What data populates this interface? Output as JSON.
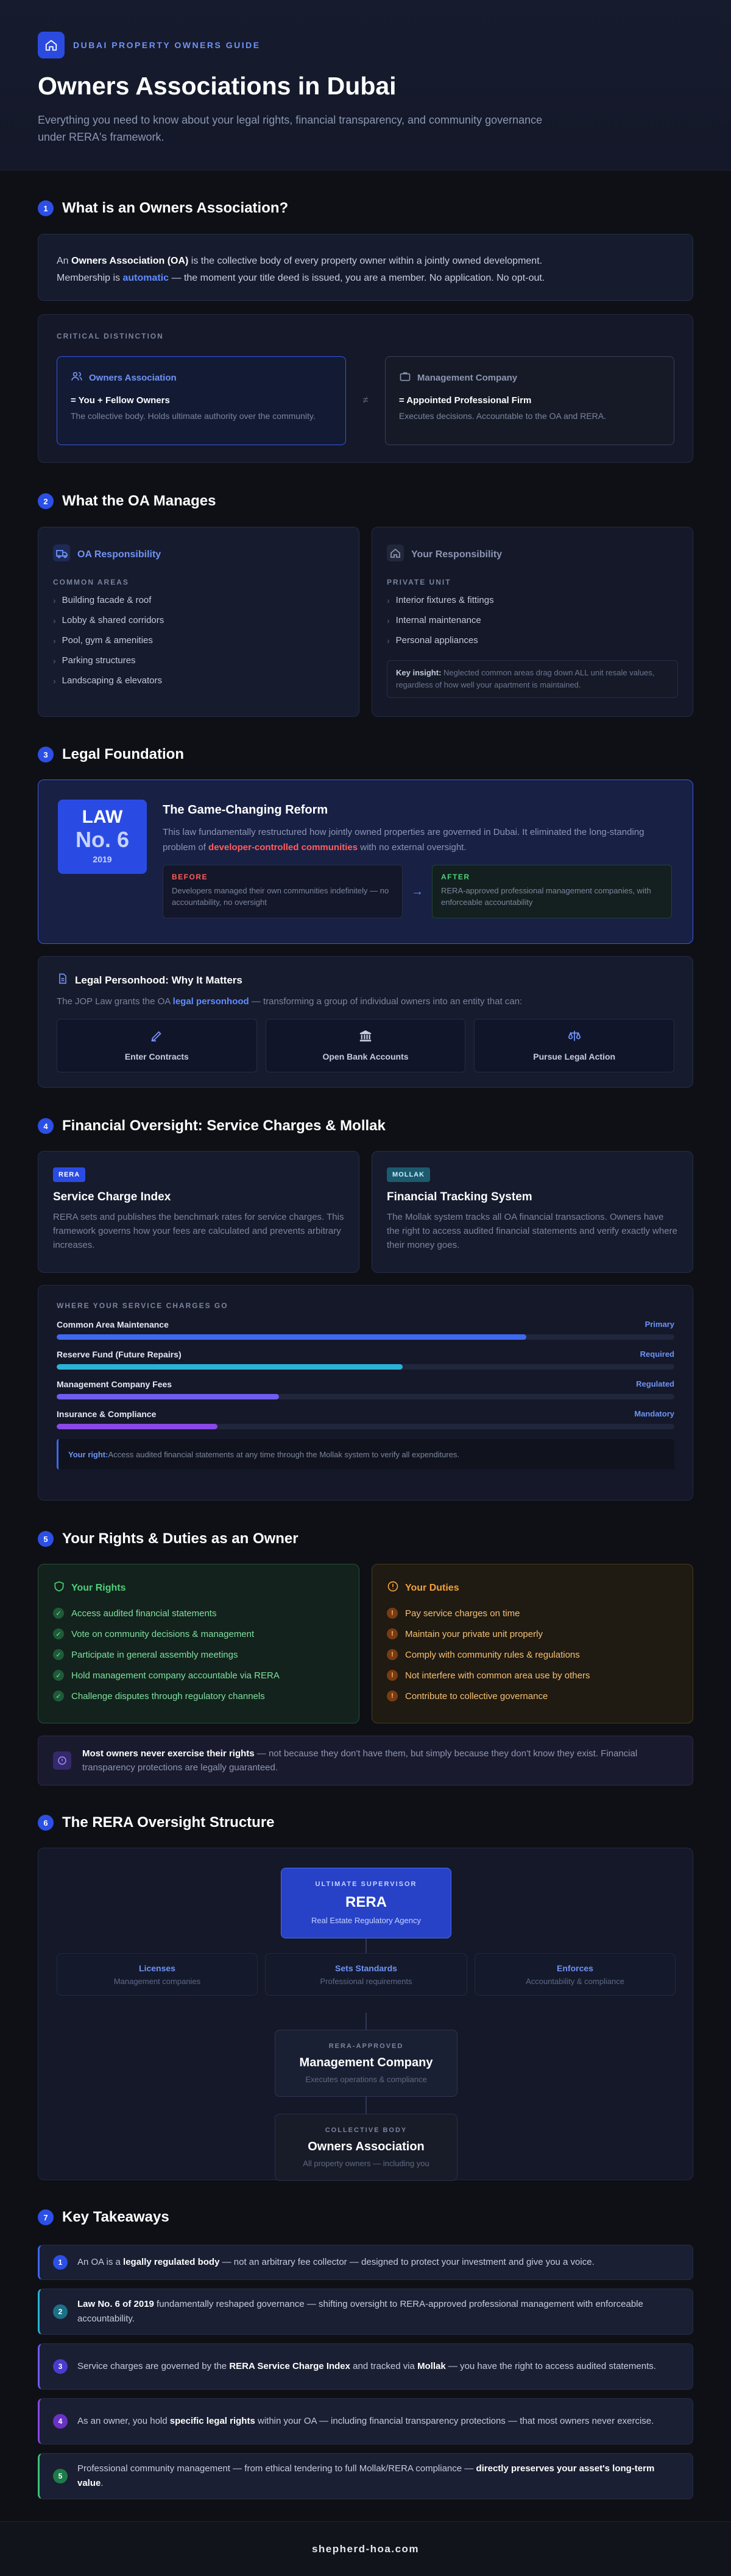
{
  "header": {
    "brand": "DUBAI PROPERTY OWNERS GUIDE",
    "title": "Owners Associations in Dubai",
    "subtitle": "Everything you need to know about your legal rights, financial transparency, and community governance under RERA's framework."
  },
  "s1": {
    "num": "1",
    "title": "What is an Owners Association?",
    "intro_a": "An ",
    "intro_b": "Owners Association (OA)",
    "intro_c": " is the collective body of every property owner within a jointly owned development.",
    "intro_d": "Membership is ",
    "intro_e": "automatic",
    "intro_f": " — the moment your title deed is issued, you are a member. No application. No opt-out.",
    "distinction_label": "CRITICAL DISTINCTION",
    "oa": {
      "title": "Owners Association",
      "eq": "= You + Fellow Owners",
      "desc": "The collective body. Holds ultimate authority over the community."
    },
    "vs": "≠",
    "mc": {
      "title": "Management Company",
      "eq": "= Appointed Professional Firm",
      "desc": "Executes decisions. Accountable to the OA and RERA."
    }
  },
  "s2": {
    "num": "2",
    "title": "What the OA Manages",
    "oa_card": {
      "title": "OA Responsibility",
      "label": "COMMON AREAS",
      "items": [
        "Building facade & roof",
        "Lobby & shared corridors",
        "Pool, gym & amenities",
        "Parking structures",
        "Landscaping & elevators"
      ]
    },
    "you_card": {
      "title": "Your Responsibility",
      "label": "PRIVATE UNIT",
      "items": [
        "Interior fixtures & fittings",
        "Internal maintenance",
        "Personal appliances"
      ]
    },
    "insight_label": "Key insight:",
    "insight_text": " Neglected common areas drag down ALL unit resale values, regardless of how well your apartment is maintained."
  },
  "s3": {
    "num": "3",
    "title": "Legal Foundation",
    "badge_top": "LAW",
    "badge_mid": "No. 6",
    "badge_year": "2019",
    "reform_title": "The Game-Changing Reform",
    "reform_a": "This law fundamentally restructured how jointly owned properties are governed in Dubai. It eliminated the long-standing problem of ",
    "reform_b": "developer-controlled communities",
    "reform_c": " with no external oversight.",
    "before_label": "BEFORE",
    "before_text": "Developers managed their own communities indefinitely — no accountability, no oversight",
    "arrow": "→",
    "after_label": "AFTER",
    "after_text": "RERA-approved professional management companies, with enforceable accountability",
    "lp_title": "Legal Personhood: Why It Matters",
    "lp_a": "The JOP Law grants the OA ",
    "lp_b": "legal personhood",
    "lp_c": " — transforming a group of individual owners into an entity that can:",
    "powers": [
      "Enter Contracts",
      "Open Bank Accounts",
      "Pursue Legal Action"
    ]
  },
  "s4": {
    "num": "4",
    "title": "Financial Oversight: Service Charges & Mollak",
    "rera_tag": "RERA",
    "rera_title": "Service Charge Index",
    "rera_desc": "RERA sets and publishes the benchmark rates for service charges. This framework governs how your fees are calculated and prevents arbitrary increases.",
    "mollak_tag": "MOLLAK",
    "mollak_title": "Financial Tracking System",
    "mollak_desc": "The Mollak system tracks all OA financial transactions. Owners have the right to access audited financial statements and verify exactly where their money goes.",
    "charges_label": "WHERE YOUR SERVICE CHARGES GO",
    "charges": [
      {
        "name": "Common Area Maintenance",
        "tag": "Primary",
        "fill": 0.76,
        "color": "#3f68f0"
      },
      {
        "name": "Reserve Fund (Future Repairs)",
        "tag": "Required",
        "fill": 0.56,
        "color": "#2ab3d6"
      },
      {
        "name": "Management Company Fees",
        "tag": "Regulated",
        "fill": 0.36,
        "color": "#6f5cf0"
      },
      {
        "name": "Insurance & Compliance",
        "tag": "Mandatory",
        "fill": 0.26,
        "color": "#8a48e6"
      }
    ],
    "right_label": "Your right:",
    "right_text": " Access audited financial statements at any time through the Mollak system to verify all expenditures."
  },
  "s5": {
    "num": "5",
    "title": "Your Rights & Duties as an Owner",
    "rights_title": "Your Rights",
    "rights": [
      "Access audited financial statements",
      "Vote on community decisions & management",
      "Participate in general assembly meetings",
      "Hold management company accountable via RERA",
      "Challenge disputes through regulatory channels"
    ],
    "duties_title": "Your Duties",
    "duties": [
      "Pay service charges on time",
      "Maintain your private unit properly",
      "Comply with community rules & regulations",
      "Not interfere with common area use by others",
      "Contribute to collective governance"
    ],
    "note_a": "Most owners never exercise their rights",
    "note_b": " — not because they don't have them, but simply because they don't know they exist. Financial transparency protections are legally guaranteed."
  },
  "s6": {
    "num": "6",
    "title": "The RERA Oversight Structure",
    "top_label": "ULTIMATE SUPERVISOR",
    "top_title": "RERA",
    "top_desc": "Real Estate Regulatory Agency",
    "pillars": [
      {
        "title": "Licenses",
        "desc": "Management companies"
      },
      {
        "title": "Sets Standards",
        "desc": "Professional requirements"
      },
      {
        "title": "Enforces",
        "desc": "Accountability & compliance"
      }
    ],
    "mid_label": "RERA-APPROVED",
    "mid_title": "Management Company",
    "mid_desc": "Executes operations & compliance",
    "bot_label": "COLLECTIVE BODY",
    "bot_title": "Owners Association",
    "bot_desc": "All property owners — including you"
  },
  "s7": {
    "num": "7",
    "title": "Key Takeaways",
    "t1_a": "An OA is a ",
    "t1_b": "legally regulated body",
    "t1_c": " — not an arbitrary fee collector — designed to protect your investment and give you a voice.",
    "t2_a": "",
    "t2_b": "Law No. 6 of 2019",
    "t2_c": " fundamentally reshaped governance — shifting oversight to RERA-approved professional management with enforceable accountability.",
    "t3_a": "Service charges are governed by the ",
    "t3_b": "RERA Service Charge Index",
    "t3_c": " and tracked via ",
    "t3_d": "Mollak",
    "t3_e": " — you have the right to access audited statements.",
    "t4_a": "As an owner, you hold ",
    "t4_b": "specific legal rights",
    "t4_c": " within your OA — including financial transparency protections — that most owners never exercise.",
    "t5_a": "Professional community management — from ethical tendering to full Mollak/RERA compliance — ",
    "t5_b": "directly preserves your asset's long-term value",
    "t5_c": "."
  },
  "footer": {
    "site": "shepherd-hoa.com"
  },
  "colors": {
    "accent": "#2c4fe6",
    "rights": "#4fd07c",
    "duties": "#f0a23a"
  }
}
